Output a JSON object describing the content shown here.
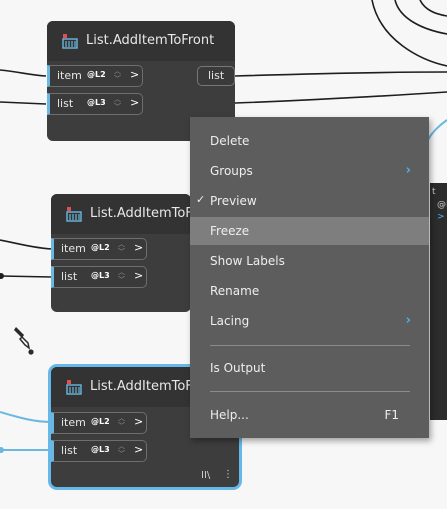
{
  "nodes": [
    {
      "title": "List.AddItemToFront",
      "inputs": [
        {
          "label": "item",
          "level": "@L2"
        },
        {
          "label": "list",
          "level": "@L3"
        }
      ],
      "output": {
        "label": "list"
      }
    },
    {
      "title": "List.AddItemToF",
      "inputs": [
        {
          "label": "item",
          "level": "@L2"
        },
        {
          "label": "list",
          "level": "@L3"
        }
      ]
    },
    {
      "title": "List.AddItemToF",
      "inputs": [
        {
          "label": "item",
          "level": "@L2"
        },
        {
          "label": "list",
          "level": "@L3"
        }
      ],
      "footer_icons": [
        "II\\",
        "⋮"
      ]
    }
  ],
  "context_menu": {
    "items": [
      {
        "label": "Delete"
      },
      {
        "label": "Groups",
        "submenu": true
      },
      {
        "label": "Preview",
        "checked": true,
        "check_mark": "✓"
      },
      {
        "label": "Freeze",
        "highlighted": true
      },
      {
        "label": "Show Labels"
      },
      {
        "label": "Rename"
      },
      {
        "label": "Lacing",
        "submenu": true
      },
      {
        "label": "Is Output"
      },
      {
        "label": "Help...",
        "shortcut": "F1"
      }
    ]
  },
  "side_panel": {
    "line1": "t",
    "line2": "@L",
    "line3": ">"
  },
  "colors": {
    "canvas": "#f7f7f7",
    "node_body": "#3d3d3d",
    "node_header": "#333333",
    "menu": "#5d5d5d",
    "menu_highlight": "#7e7e7e",
    "accent": "#66b8e8",
    "wire": "#1e1e1e"
  }
}
